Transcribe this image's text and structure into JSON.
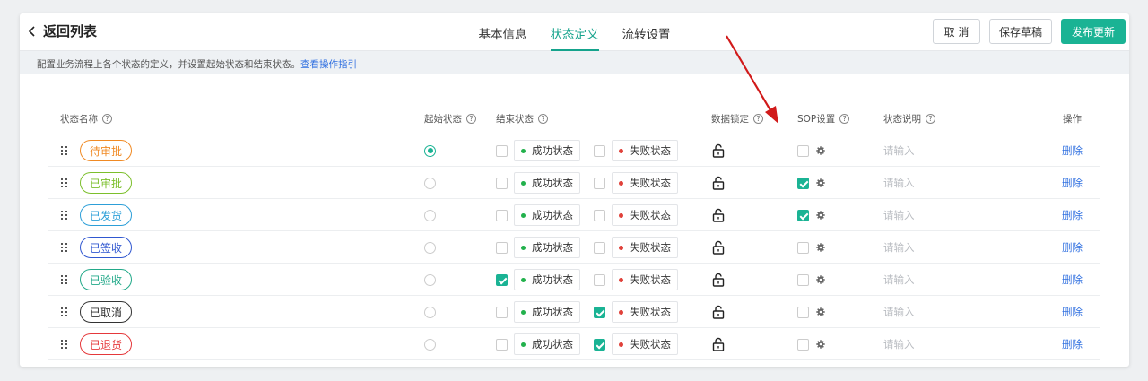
{
  "header": {
    "back_label": "返回列表",
    "tabs": [
      "基本信息",
      "状态定义",
      "流转设置"
    ],
    "active_tab": 1,
    "cancel_label": "取 消",
    "save_draft_label": "保存草稿",
    "publish_label": "发布更新"
  },
  "hint": {
    "text": "配置业务流程上各个状态的定义，并设置起始状态和结束状态。",
    "link": "查看操作指引"
  },
  "columns": {
    "name": "状态名称",
    "start": "起始状态",
    "end": "结束状态",
    "lock": "数据锁定",
    "sop": "SOP设置",
    "desc": "状态说明",
    "ops": "操作"
  },
  "labels": {
    "success": "成功状态",
    "failure": "失败状态",
    "placeholder": "请输入",
    "delete": "删除"
  },
  "colors": {
    "accent": "#1ab394",
    "link": "#2f6fe0",
    "success_dot": "#22b14c",
    "failure_dot": "#e0413a",
    "arrow": "#d11a1a"
  },
  "rows": [
    {
      "name": "待审批",
      "color": "#f08a24",
      "start": true,
      "success": false,
      "failure": false,
      "sop": false
    },
    {
      "name": "已审批",
      "color": "#7cbf2c",
      "start": false,
      "success": false,
      "failure": false,
      "sop": true
    },
    {
      "name": "已发货",
      "color": "#2d9fd8",
      "start": false,
      "success": false,
      "failure": false,
      "sop": true
    },
    {
      "name": "已签收",
      "color": "#3057d0",
      "start": false,
      "success": false,
      "failure": false,
      "sop": false
    },
    {
      "name": "已验收",
      "color": "#22a989",
      "start": false,
      "success": true,
      "failure": false,
      "sop": false
    },
    {
      "name": "已取消",
      "color": "#333333",
      "start": false,
      "success": false,
      "failure": true,
      "sop": false
    },
    {
      "name": "已退货",
      "color": "#e5383b",
      "start": false,
      "success": false,
      "failure": true,
      "sop": false
    }
  ]
}
